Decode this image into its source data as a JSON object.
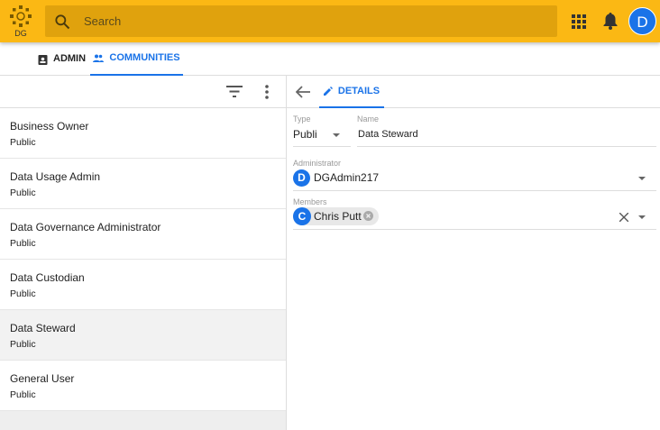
{
  "header": {
    "logo_text": "DG",
    "search_placeholder": "Search",
    "avatar_initial": "D"
  },
  "tabs": [
    {
      "label": "ADMIN"
    },
    {
      "label": "COMMUNITIES",
      "active": true
    }
  ],
  "list": [
    {
      "title": "Business Owner",
      "subtitle": "Public"
    },
    {
      "title": "Data Usage Admin",
      "subtitle": "Public"
    },
    {
      "title": "Data Governance Administrator",
      "subtitle": "Public"
    },
    {
      "title": "Data Custodian",
      "subtitle": "Public"
    },
    {
      "title": "Data Steward",
      "subtitle": "Public",
      "selected": true
    },
    {
      "title": "General User",
      "subtitle": "Public"
    }
  ],
  "details": {
    "tab_label": "DETAILS",
    "type_label": "Type",
    "type_value": "Publi",
    "name_label": "Name",
    "name_value": "Data Steward",
    "admin_label": "Administrator",
    "admin_initial": "D",
    "admin_value": "DGAdmin217",
    "members_label": "Members",
    "member_initial": "C",
    "member_value": "Chris Putt"
  },
  "colors": {
    "header": "#fbb814",
    "accent": "#1a73e8"
  }
}
